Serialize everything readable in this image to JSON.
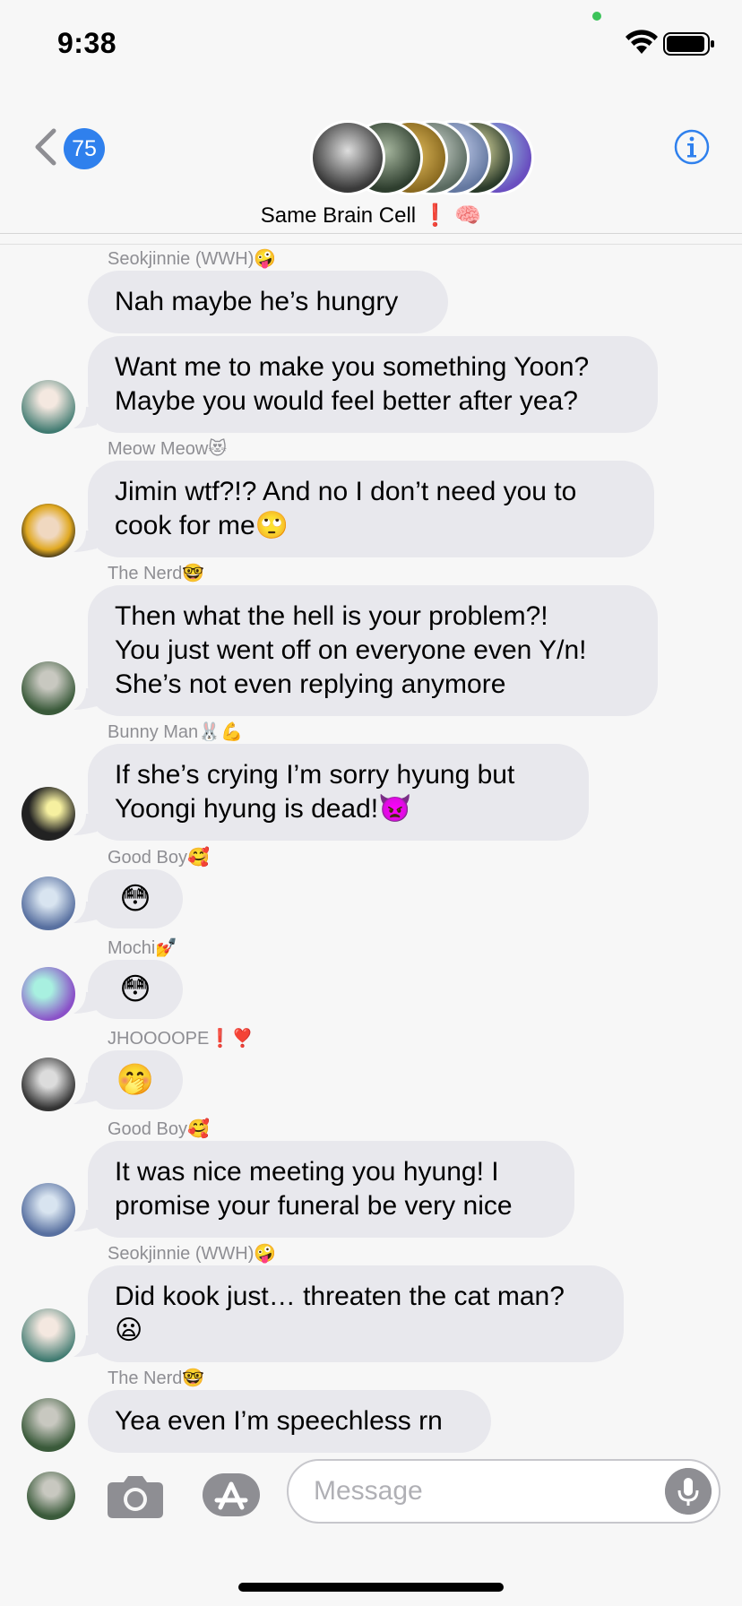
{
  "status": {
    "time": "9:38"
  },
  "header": {
    "unread_count": "75",
    "group_name": "Same Brain Cell ❗️ 🧠"
  },
  "messages": [
    {
      "sender": "Seokjinnie (WWH)🤪",
      "text": "Nah maybe he’s hungry"
    },
    {
      "text_lines": [
        "Want me to make you something Yoon?",
        "Maybe you would feel better after yea?"
      ]
    },
    {
      "sender": "Meow Meow😻",
      "text_lines": [
        "Jimin wtf?!? And no I don’t need you to",
        "cook for me🙄"
      ]
    },
    {
      "sender": "The Nerd🤓",
      "text_lines": [
        "Then what the hell is your problem?!",
        "You just went off on everyone even Y/n!",
        "She’s not even replying anymore"
      ]
    },
    {
      "sender": "Bunny Man🐰💪",
      "text_lines": [
        "If she’s crying I’m sorry hyung but",
        "Yoongi hyung is dead!👿"
      ]
    },
    {
      "sender": "Good Boy🥰",
      "text": "😳"
    },
    {
      "sender": "Mochi💅",
      "text": "😳"
    },
    {
      "sender": "JHOOOOPE❗️❣️",
      "text": "🤭"
    },
    {
      "sender": "Good Boy🥰",
      "text_lines": [
        "It was nice meeting you hyung! I",
        "promise your funeral be very nice"
      ]
    },
    {
      "sender": "Seokjinnie (WWH)🤪",
      "text_lines": [
        "Did kook just… threaten the cat man?",
        "😦"
      ]
    },
    {
      "sender": "The Nerd🤓",
      "text": "Yea even I’m speechless rn"
    }
  ],
  "input": {
    "placeholder": "Message"
  },
  "colors": {
    "accent": "#2f80ed",
    "bubble": "#e8e8ed",
    "background": "#f7f7f7"
  }
}
